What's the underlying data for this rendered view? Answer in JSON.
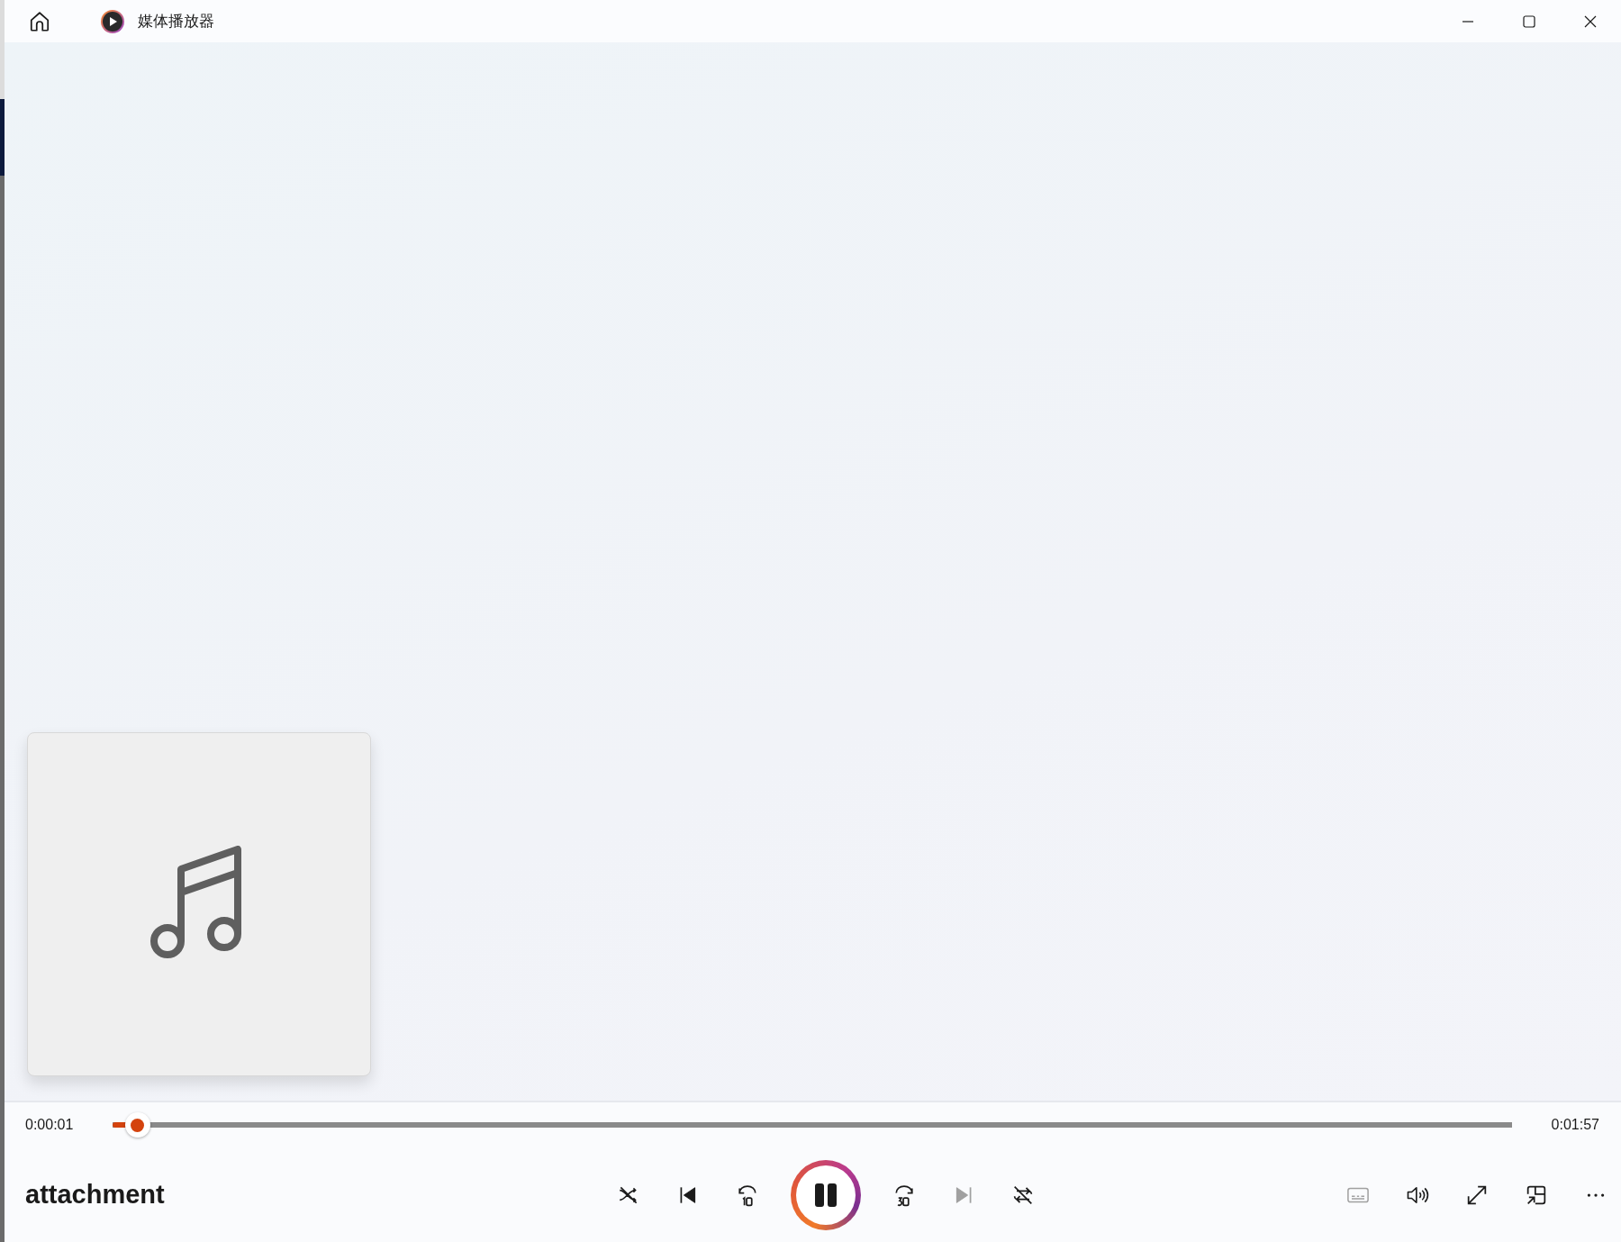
{
  "window": {
    "title": "媒体播放器"
  },
  "player": {
    "elapsed": "0:00:01",
    "duration": "0:01:57",
    "progress": {
      "level": 0.018
    },
    "track_title": "attachment",
    "playing": true,
    "shuffle": false,
    "repeat": false,
    "next_disabled": true,
    "subtitles_disabled": true
  }
}
